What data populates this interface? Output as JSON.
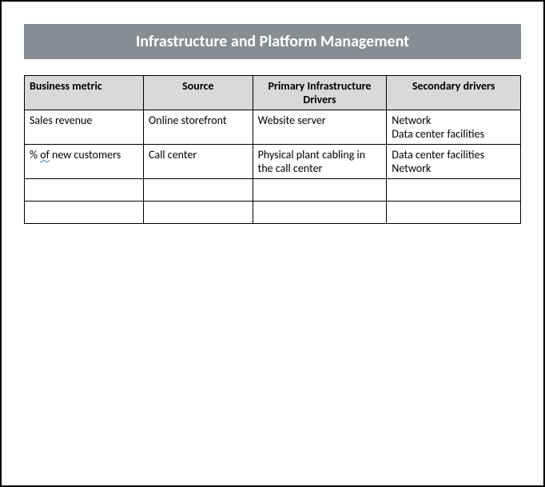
{
  "title": "Infrastructure and Platform Management",
  "headers": {
    "c0": "Business metric",
    "c1": "Source",
    "c2": "Primary Infrastructure Drivers",
    "c3": "Secondary drivers"
  },
  "rows": [
    {
      "c0_pre": "Sales revenue",
      "c0_u": "",
      "c0_post": "",
      "c1": "Online storefront",
      "c2": "Website server",
      "c3_l1": "Network",
      "c3_l2": "Data center facilities"
    },
    {
      "c0_pre": "% ",
      "c0_u": "of",
      "c0_post": " new customers",
      "c1": "Call center",
      "c2": "Physical plant cabling in the call center",
      "c3_l1": "Data center facilities",
      "c3_l2": "Network"
    },
    {
      "c0_pre": "",
      "c0_u": "",
      "c0_post": "",
      "c1": "",
      "c2": "",
      "c3_l1": "",
      "c3_l2": ""
    },
    {
      "c0_pre": "",
      "c0_u": "",
      "c0_post": "",
      "c1": "",
      "c2": "",
      "c3_l1": "",
      "c3_l2": ""
    }
  ],
  "chart_data": {
    "type": "table",
    "title": "Infrastructure and Platform Management",
    "columns": [
      "Business metric",
      "Source",
      "Primary Infrastructure Drivers",
      "Secondary drivers"
    ],
    "rows": [
      [
        "Sales revenue",
        "Online storefront",
        "Website server",
        "Network; Data center facilities"
      ],
      [
        "% of new customers",
        "Call center",
        "Physical plant cabling in the call center",
        "Data center facilities; Network"
      ],
      [
        "",
        "",
        "",
        ""
      ],
      [
        "",
        "",
        "",
        ""
      ]
    ]
  }
}
